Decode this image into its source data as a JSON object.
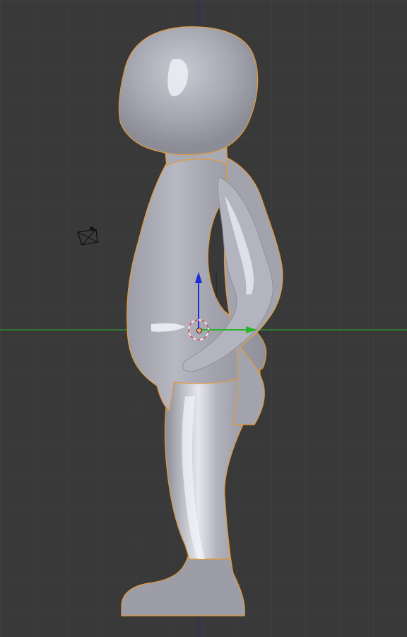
{
  "viewport": {
    "background_color": "#393939",
    "grid_color": "#444444",
    "view": "side-orthographic"
  },
  "axes": {
    "x_axis_color": "#2e8b2e",
    "z_axis_color": "#2a2a8c"
  },
  "object": {
    "type": "mesh",
    "selected": true,
    "mesh_color": "#a7a8b4",
    "selection_outline_color": "#e39a3a"
  },
  "gizmo": {
    "z_arrow_color": "#1c2bd6",
    "y_arrow_color": "#2bb52b",
    "origin_color": "#f4a27a"
  },
  "icons": {
    "camera": "camera-icon",
    "origin": "object-origin-icon",
    "cursor": "3d-cursor-icon"
  }
}
